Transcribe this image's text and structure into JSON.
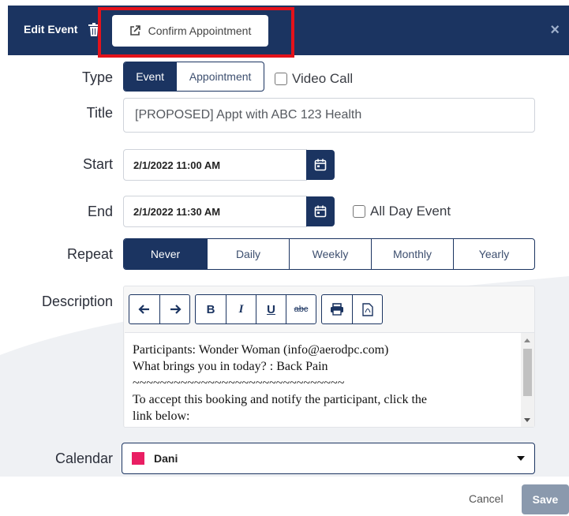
{
  "header": {
    "title": "Edit Event",
    "confirm_label": "Confirm Appointment",
    "close_glyph": "×",
    "trash_icon": "trash-icon",
    "confirm_icon": "external-link-icon"
  },
  "type": {
    "label": "Type",
    "options": [
      "Event",
      "Appointment"
    ],
    "selected": "Event",
    "video_call_label": "Video Call",
    "video_call_checked": false
  },
  "title_field": {
    "label": "Title",
    "value": "[PROPOSED] Appt with ABC 123 Health"
  },
  "start": {
    "label": "Start",
    "value": "2/1/2022 11:00 AM"
  },
  "end": {
    "label": "End",
    "value": "2/1/2022 11:30 AM",
    "all_day_label": "All Day Event",
    "all_day_checked": false
  },
  "repeat": {
    "label": "Repeat",
    "options": [
      "Never",
      "Daily",
      "Weekly",
      "Monthly",
      "Yearly"
    ],
    "selected": "Never"
  },
  "description": {
    "label": "Description",
    "toolbar": {
      "undo_icon": "undo-icon",
      "redo_icon": "redo-icon",
      "bold": "B",
      "italic": "I",
      "underline": "U",
      "strike": "abc",
      "print_icon": "print-icon",
      "pdf_icon": "pdf-icon"
    },
    "lines": [
      "Participants: Wonder Woman (info@aerodpc.com)",
      "What brings you in today? : Back Pain",
      "~~~~~~~~~~~~~~~~~~~~~~~~~~~~~~~",
      "To accept this booking and notify the participant, click the",
      "link below:"
    ]
  },
  "calendar": {
    "label": "Calendar",
    "value": "Dani",
    "color": "#e91e63"
  },
  "footer": {
    "cancel_label": "Cancel",
    "save_label": "Save"
  },
  "colors": {
    "primary": "#1b3461",
    "highlight_border": "#e3121b",
    "save_disabled": "#8a99ad"
  }
}
